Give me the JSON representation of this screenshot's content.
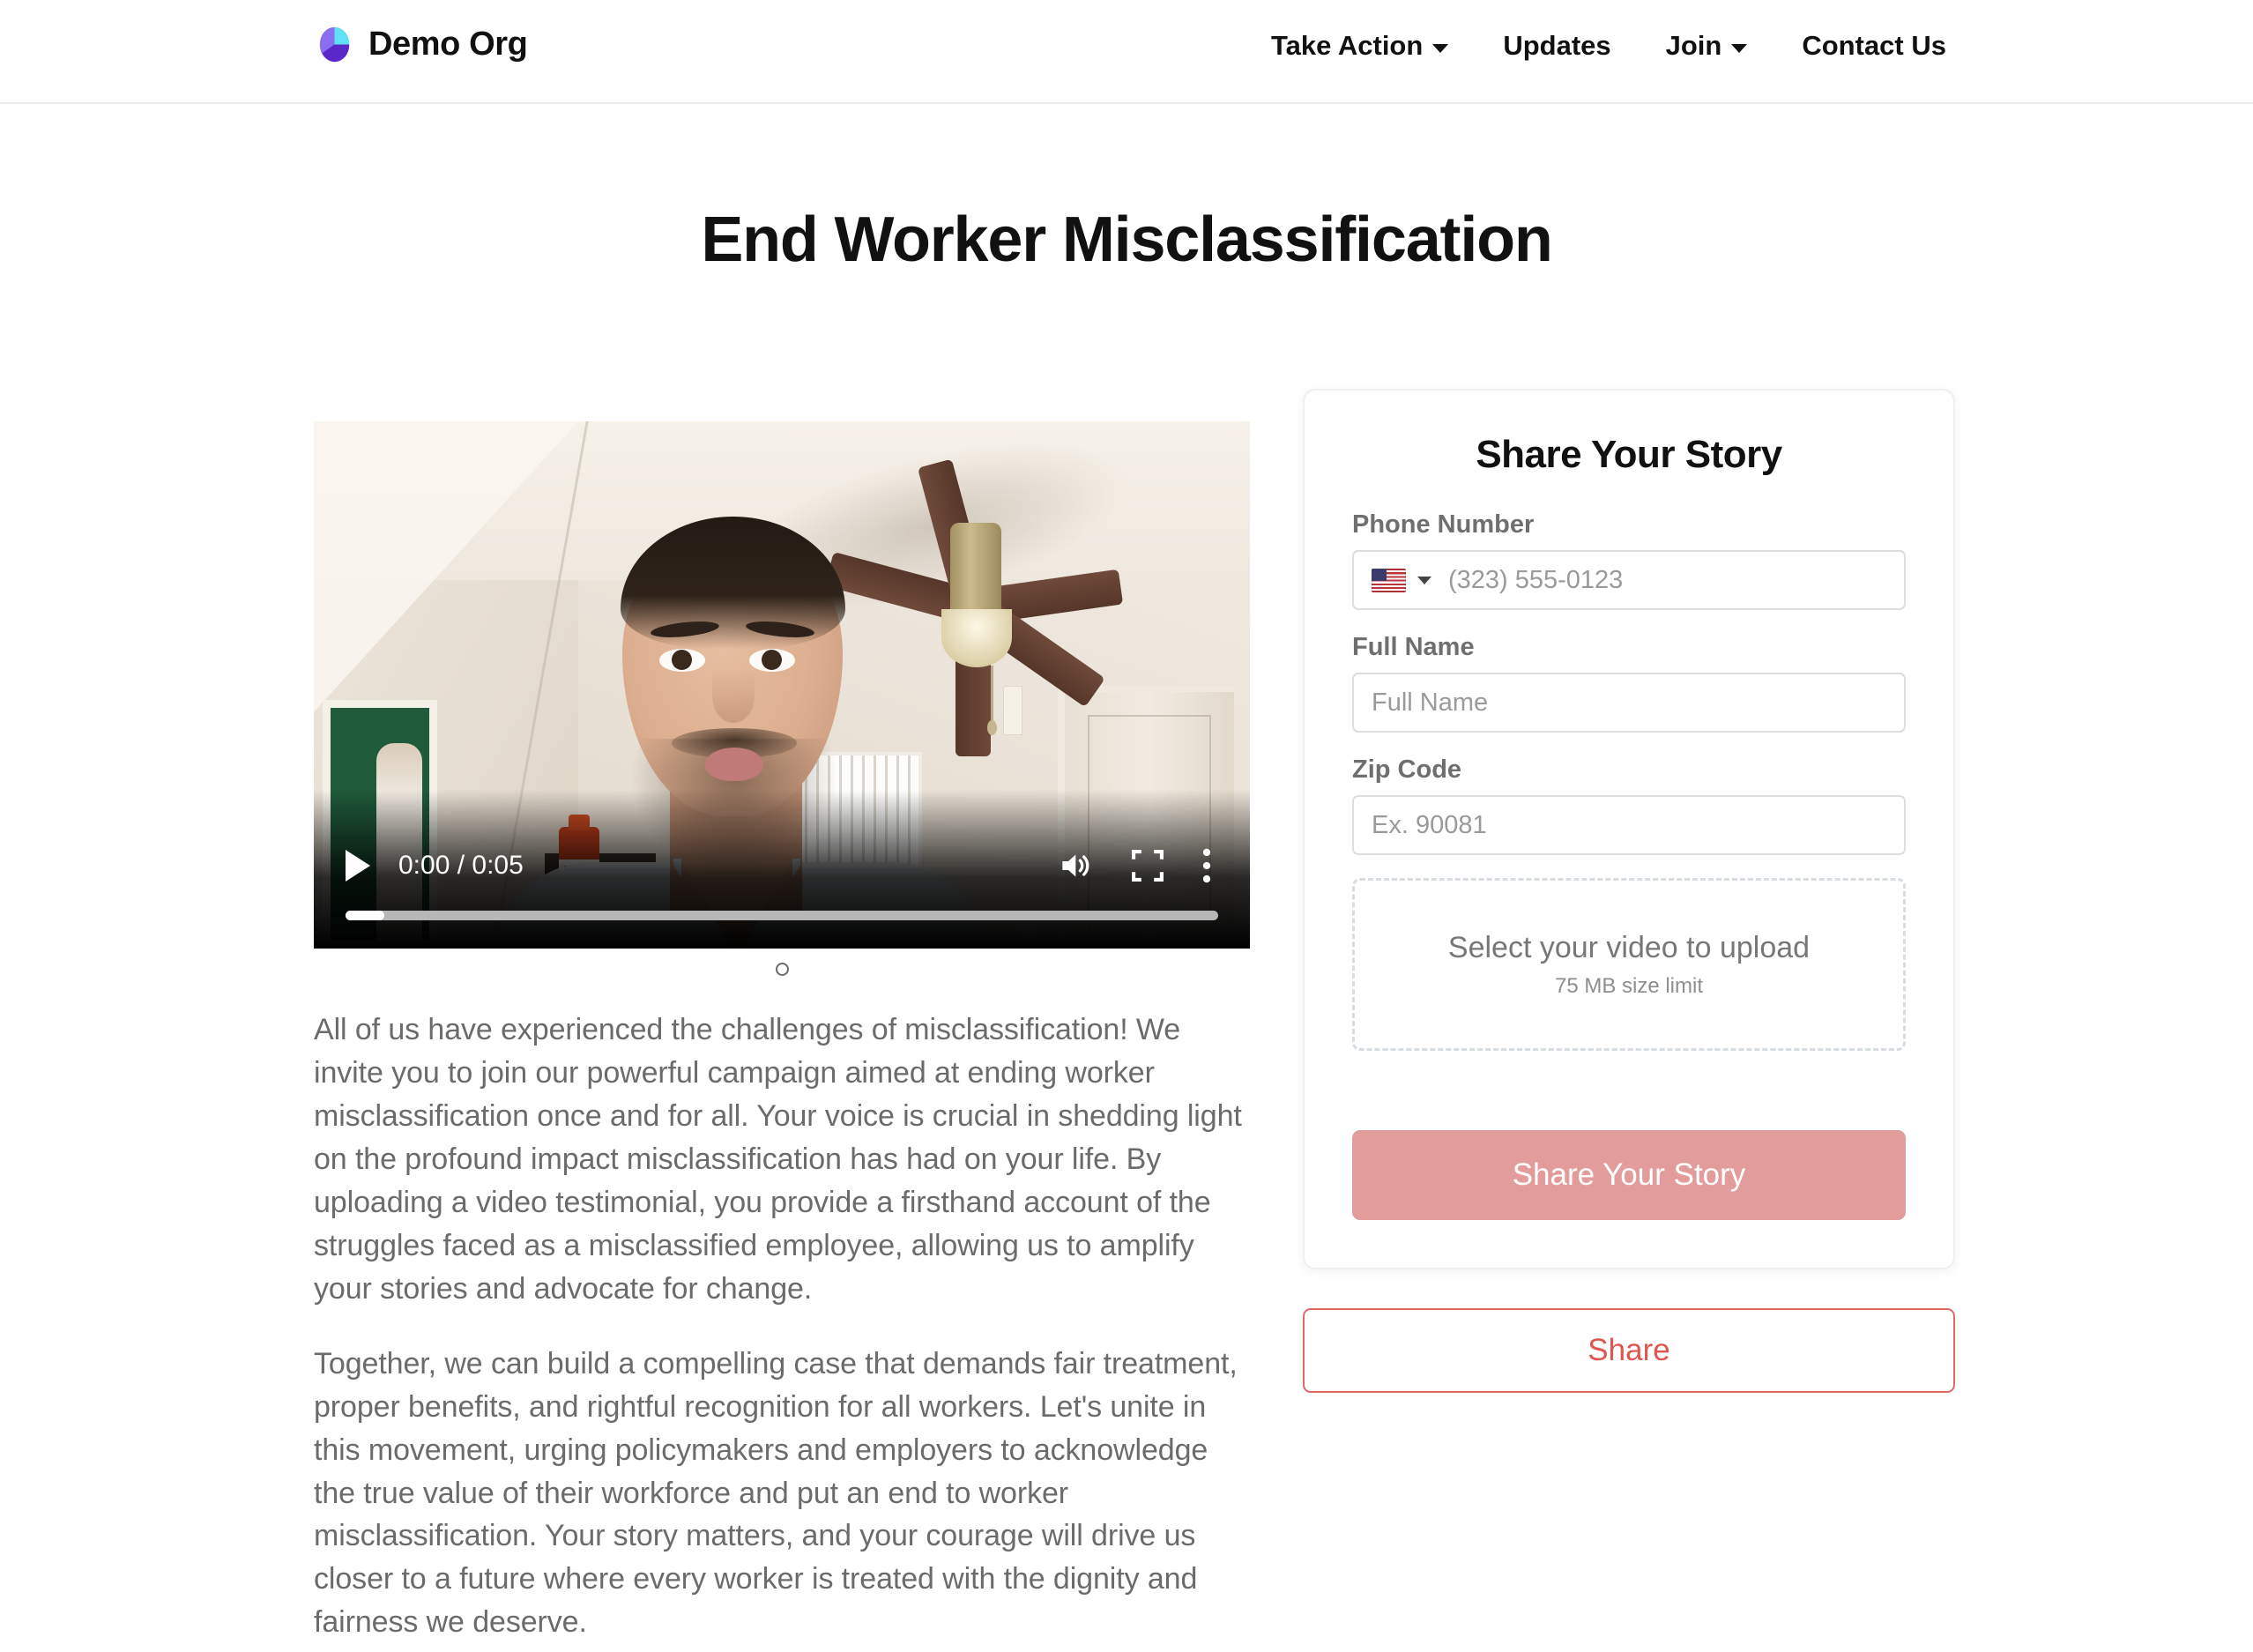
{
  "header": {
    "brand_name": "Demo Org",
    "logo_colors": {
      "light_purple": "#8a6ef0",
      "cyan": "#5fe0f5",
      "dark_purple": "#5a28c8"
    },
    "nav": [
      {
        "label": "Take Action",
        "has_dropdown": true
      },
      {
        "label": "Updates",
        "has_dropdown": false
      },
      {
        "label": "Join",
        "has_dropdown": true
      },
      {
        "label": "Contact Us",
        "has_dropdown": false
      }
    ]
  },
  "page": {
    "title": "End Worker Misclassification"
  },
  "video": {
    "current_time": "0:00",
    "duration": "0:05",
    "time_display": "0:00 / 0:05",
    "progress_percent": 0,
    "icons": {
      "play": "play-icon",
      "volume": "volume-icon",
      "fullscreen": "fullscreen-icon",
      "more": "more-options-icon"
    }
  },
  "carousel": {
    "dots": 1,
    "active_index": 0
  },
  "body": {
    "paragraph_1": "All of us have experienced the challenges of misclassification! We invite you to join our powerful campaign aimed at ending worker misclassification once and for all. Your voice is crucial in shedding light on the profound impact misclassification has had on your life. By uploading a video testimonial, you provide a firsthand account of the struggles faced as a misclassified employee, allowing us to amplify your stories and advocate for change.",
    "paragraph_2": "Together, we can build a compelling case that demands fair treatment, proper benefits, and rightful recognition for all workers. Let's unite in this movement, urging policymakers and employers to acknowledge the true value of their workforce and put an end to worker misclassification. Your story matters, and your courage will drive us closer to a future where every worker is treated with the dignity and fairness we deserve."
  },
  "form": {
    "title": "Share Your Story",
    "phone": {
      "label": "Phone Number",
      "country": "US",
      "value": "",
      "placeholder": "(323) 555-0123"
    },
    "full_name": {
      "label": "Full Name",
      "value": "",
      "placeholder": "Full Name"
    },
    "zip": {
      "label": "Zip Code",
      "value": "",
      "placeholder": "Ex. 90081"
    },
    "upload": {
      "prompt": "Select your video to upload",
      "size_limit": "75 MB size limit"
    },
    "submit_label": "Share Your Story",
    "submit_color": "#e29c9c"
  },
  "share_button": {
    "label": "Share",
    "text_color": "#e0564f",
    "border_color": "#e06a63"
  }
}
